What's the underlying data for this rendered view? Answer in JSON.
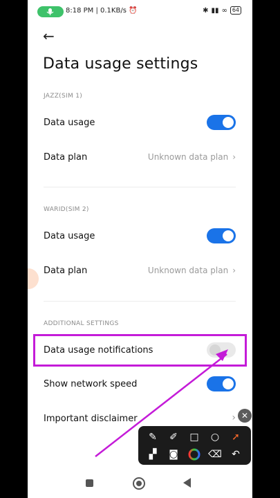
{
  "status_bar": {
    "time_and_speed": "8:18 PM | 0.1KB/s",
    "battery": "64"
  },
  "page": {
    "title": "Data usage settings"
  },
  "sections": [
    {
      "header": "JAZZ(SIM 1)",
      "rows": [
        {
          "label": "Data usage",
          "toggle": "on"
        },
        {
          "label": "Data plan",
          "value": "Unknown data plan"
        }
      ]
    },
    {
      "header": "WARID(SIM 2)",
      "rows": [
        {
          "label": "Data usage",
          "toggle": "on"
        },
        {
          "label": "Data plan",
          "value": "Unknown data plan"
        }
      ]
    },
    {
      "header": "ADDITIONAL SETTINGS",
      "rows": [
        {
          "label": "Data usage notifications",
          "toggle": "off"
        },
        {
          "label": "Show network speed",
          "toggle": "on"
        },
        {
          "label": "Important disclaimer"
        }
      ]
    }
  ],
  "colors": {
    "toggle_on": "#1a73e8",
    "annotation": "#c41bd8",
    "accent_orange": "#ff6a2b"
  },
  "toolbar_icons": [
    "brush-icon",
    "marker-icon",
    "rectangle-icon",
    "circle-icon",
    "arrow-icon",
    "mosaic-icon",
    "camera-icon",
    "color-wheel-icon",
    "eraser-icon",
    "undo-icon"
  ]
}
